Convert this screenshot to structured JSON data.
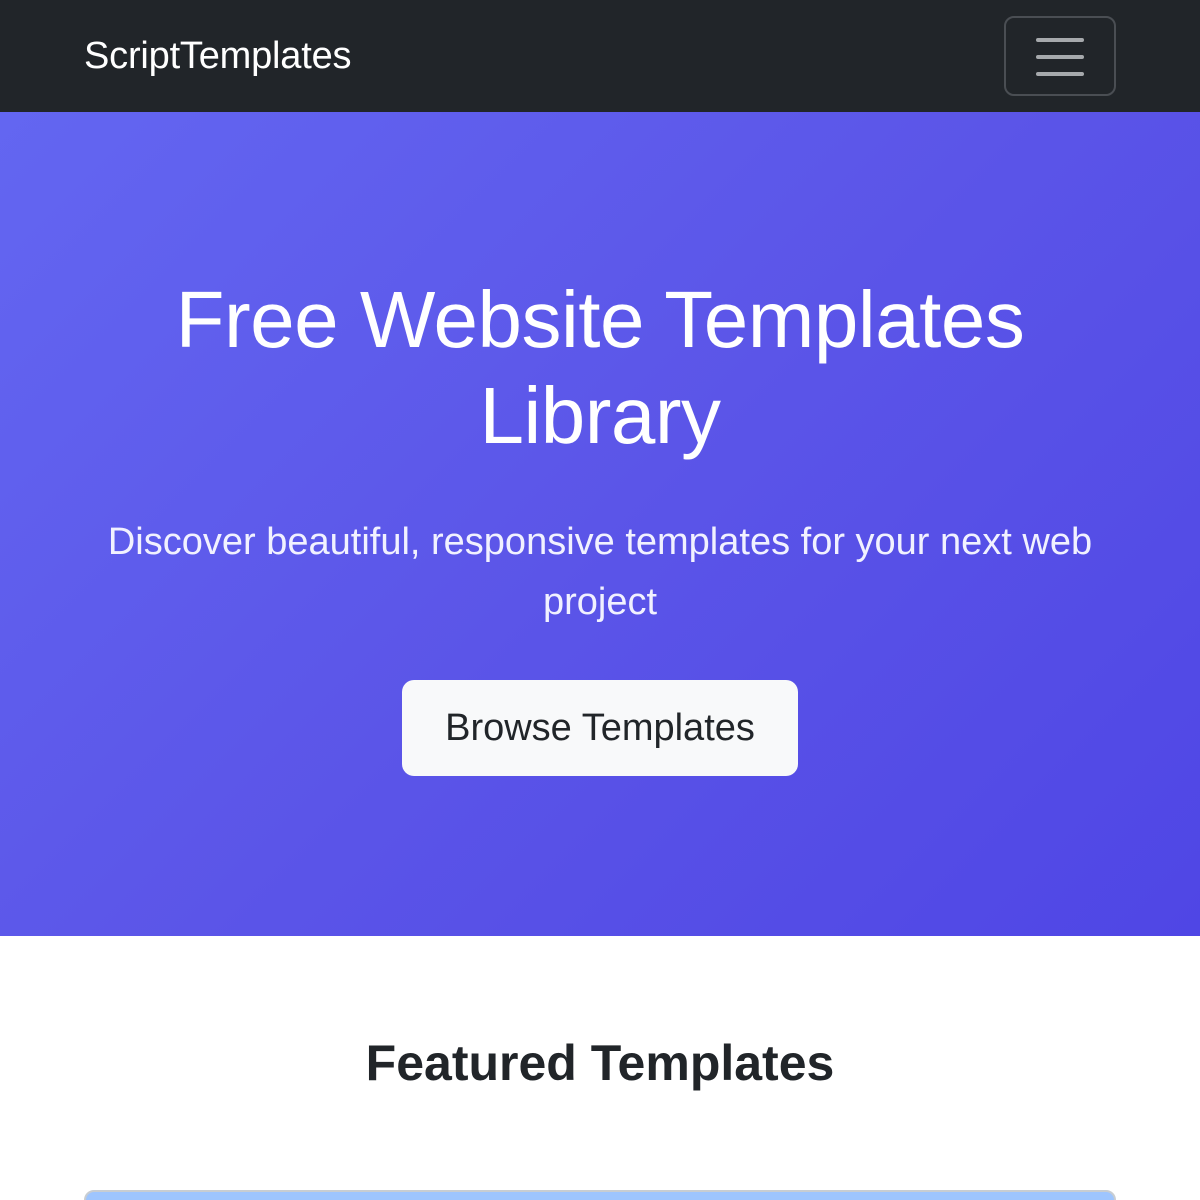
{
  "navbar": {
    "brand": "ScriptTemplates",
    "toggler_icon": "hamburger-menu-icon"
  },
  "hero": {
    "title": "Free Website Templates Library",
    "subtitle": "Discover beautiful, responsive templates for your next web project",
    "cta_label": "Browse Templates"
  },
  "featured": {
    "title": "Featured Templates"
  },
  "colors": {
    "navbar_bg": "#212529",
    "hero_gradient_start": "#6366f1",
    "hero_gradient_end": "#4f46e5",
    "button_bg": "#f8f9fa",
    "card_accent": "#9ec5fe"
  }
}
